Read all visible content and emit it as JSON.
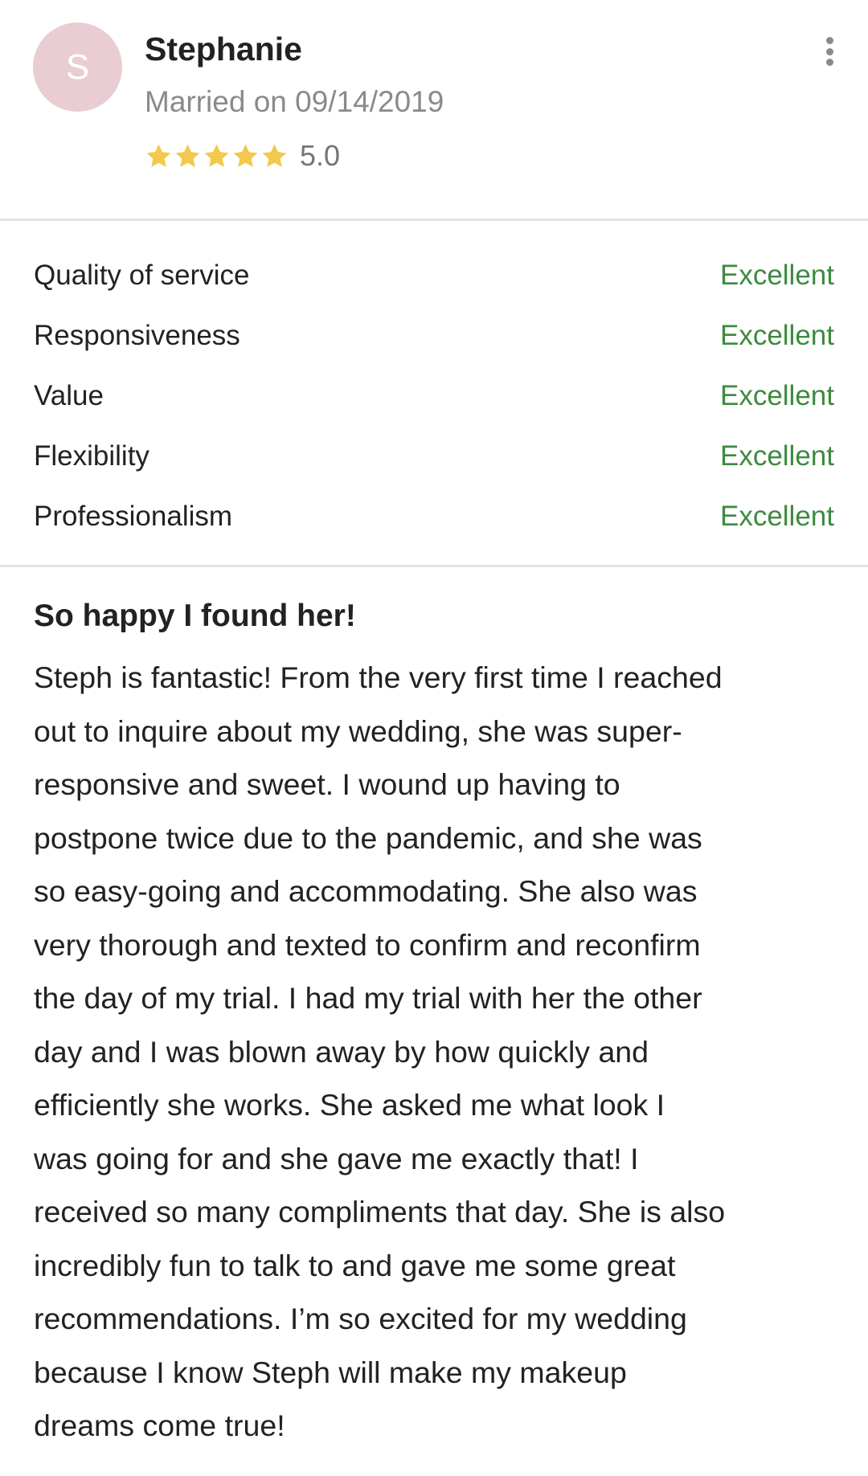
{
  "reviewer": {
    "initial": "S",
    "name": "Stephanie",
    "married_on": "Married on 09/14/2019",
    "rating": "5.0",
    "stars": 5,
    "star_color": "#f2c94c",
    "avatar_color": "#e9cdd3"
  },
  "ratings": [
    {
      "label": "Quality of service",
      "value": "Excellent"
    },
    {
      "label": "Responsiveness",
      "value": "Excellent"
    },
    {
      "label": "Value",
      "value": "Excellent"
    },
    {
      "label": "Flexibility",
      "value": "Excellent"
    },
    {
      "label": "Professionalism",
      "value": "Excellent"
    }
  ],
  "grade_color": "#3d8a3f",
  "review": {
    "title": "So happy I found her!",
    "lines": [
      "Steph is fantastic! From the very first time I reached",
      "out to inquire about my wedding, she was super-",
      "responsive and sweet. I wound up having to",
      "postpone twice due to the pandemic, and she was",
      "so easy-going and accommodating. She also was",
      "very thorough and texted to confirm and reconfirm",
      "the day of my trial. I had my trial with her the other",
      "day and I was blown away by how quickly and",
      "efficiently she works. She asked me what look I",
      "was going for and she gave me exactly that! I",
      "received so many compliments that day. She is also",
      "incredibly fun to talk to and gave me some great",
      "recommendations. I’m so excited for my wedding",
      "because I know Steph will make my makeup",
      "dreams come true!"
    ]
  },
  "icons": {
    "avatar": "avatar-initial",
    "more": "more-vertical-icon",
    "star": "star-icon"
  }
}
